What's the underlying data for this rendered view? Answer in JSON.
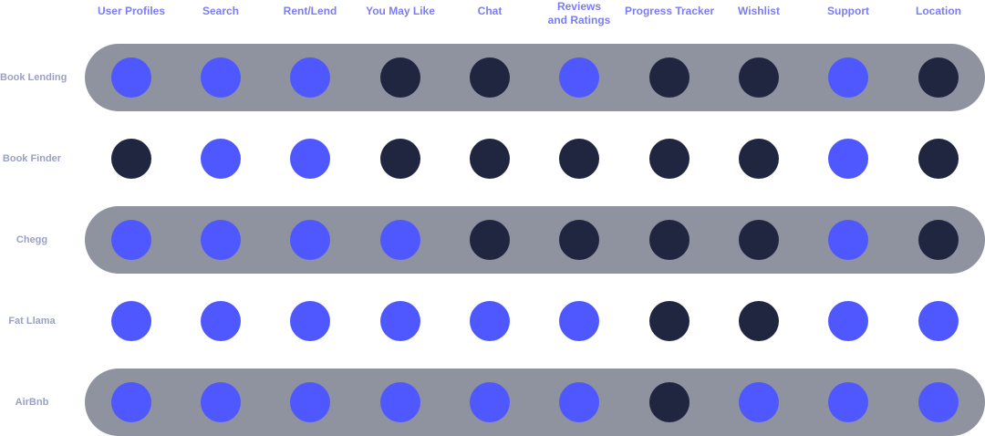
{
  "colors": {
    "feature_yes": "#4f58fe",
    "feature_no": "#212640",
    "band": "#8f93a0",
    "header_text": "#7b7df4",
    "row_label_text": "#9aa1c8"
  },
  "columns": [
    "User Profiles",
    "Search",
    "Rent/Lend",
    "You May Like",
    "Chat",
    "Reviews\nand Ratings",
    "Progress Tracker",
    "Wishlist",
    "Support",
    "Location"
  ],
  "rows": [
    {
      "label": "Book Lending",
      "banded": true,
      "features": [
        1,
        1,
        1,
        0,
        0,
        1,
        0,
        0,
        1,
        0
      ]
    },
    {
      "label": "Book Finder",
      "banded": false,
      "features": [
        0,
        1,
        1,
        0,
        0,
        0,
        0,
        0,
        1,
        0
      ]
    },
    {
      "label": "Chegg",
      "banded": true,
      "features": [
        1,
        1,
        1,
        1,
        0,
        0,
        0,
        0,
        1,
        0
      ]
    },
    {
      "label": "Fat Llama",
      "banded": false,
      "features": [
        1,
        1,
        1,
        1,
        1,
        1,
        0,
        0,
        1,
        1
      ]
    },
    {
      "label": "AirBnb",
      "banded": true,
      "features": [
        1,
        1,
        1,
        1,
        1,
        1,
        0,
        1,
        1,
        1
      ]
    }
  ]
}
